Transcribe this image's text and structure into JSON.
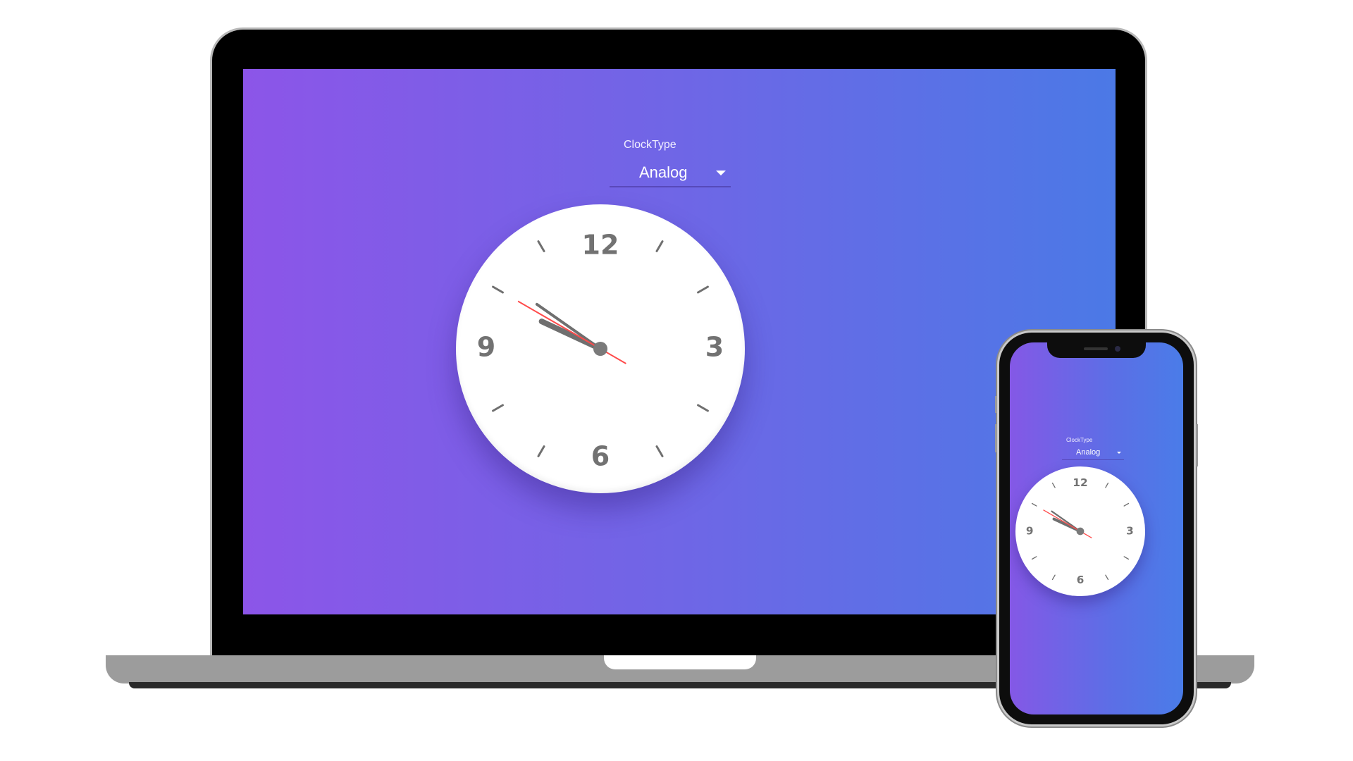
{
  "laptop_app": {
    "clock_type_label": "ClockType",
    "clock_type_value": "Analog",
    "clock_numbers": [
      "12",
      "3",
      "6",
      "9"
    ]
  },
  "phone_app": {
    "clock_type_label": "ClockType",
    "clock_type_value": "Analog",
    "clock_numbers": [
      "12",
      "3",
      "6",
      "9"
    ]
  },
  "clock_time": {
    "hours": 9,
    "minutes": 50,
    "seconds": 50
  },
  "colors": {
    "gradient_start": "#8c55e8",
    "gradient_end": "#4b79e6",
    "hand_color": "#6f6f6f",
    "second_hand_color": "#ff4b4b",
    "number_color": "#727272"
  },
  "icons": {
    "dropdown": "caret-down-icon"
  }
}
